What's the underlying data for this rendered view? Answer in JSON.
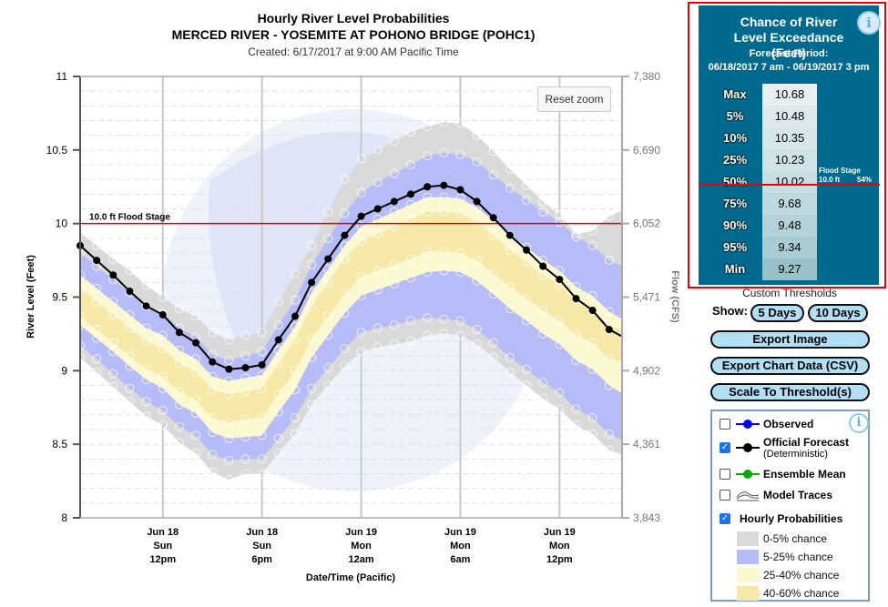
{
  "header": {
    "title": "Hourly River Level Probabilities",
    "subtitle": "MERCED RIVER - YOSEMITE AT POHONO BRIDGE (POHC1)",
    "created": "Created: 6/17/2017 at 9:00 AM Pacific Time"
  },
  "reset_zoom": "Reset zoom",
  "chart_data": {
    "type": "area",
    "title": "Hourly River Level Probabilities",
    "ylabel": "River Level (Feet)",
    "y2label": "Flow (CFS)",
    "xlabel": "Date/Time (Pacific)",
    "ylim": [
      8,
      11
    ],
    "yticks": [
      "11",
      "10.5",
      "10",
      "9.5",
      "9",
      "8.5",
      "8"
    ],
    "y2ticks": [
      "7,380",
      "6,690",
      "6,052",
      "5,471",
      "4,902",
      "4,361",
      "3,843"
    ],
    "xticks": [
      {
        "at": "06/18 12:00",
        "l1": "Jun 18",
        "l2": "Sun",
        "l3": "12pm"
      },
      {
        "at": "06/18 18:00",
        "l1": "Jun 18",
        "l2": "Sun",
        "l3": "6pm"
      },
      {
        "at": "06/19 00:00",
        "l1": "Jun 19",
        "l2": "Mon",
        "l3": "12am"
      },
      {
        "at": "06/19 06:00",
        "l1": "Jun 19",
        "l2": "Mon",
        "l3": "6am"
      },
      {
        "at": "06/19 12:00",
        "l1": "Jun 19",
        "l2": "Mon",
        "l3": "12pm"
      }
    ],
    "grid": true,
    "flood_stage": {
      "value": 10.0,
      "label": "10.0 ft Flood Stage",
      "color": "#e00000"
    },
    "x": [
      "06/18 07:00",
      "06/18 08:00",
      "06/18 09:00",
      "06/18 10:00",
      "06/18 11:00",
      "06/18 12:00",
      "06/18 13:00",
      "06/18 14:00",
      "06/18 15:00",
      "06/18 16:00",
      "06/18 17:00",
      "06/18 18:00",
      "06/18 19:00",
      "06/18 20:00",
      "06/18 21:00",
      "06/18 22:00",
      "06/18 23:00",
      "06/19 00:00",
      "06/19 01:00",
      "06/19 02:00",
      "06/19 03:00",
      "06/19 04:00",
      "06/19 05:00",
      "06/19 06:00",
      "06/19 07:00",
      "06/19 08:00",
      "06/19 09:00",
      "06/19 10:00",
      "06/19 11:00",
      "06/19 12:00",
      "06/19 13:00",
      "06/19 14:00",
      "06/19 15:00",
      "06/19 16:00"
    ],
    "forecast": [
      9.85,
      9.75,
      9.65,
      9.54,
      9.44,
      9.38,
      9.26,
      9.19,
      9.06,
      9.01,
      9.02,
      9.04,
      9.21,
      9.37,
      9.6,
      9.76,
      9.92,
      10.05,
      10.1,
      10.15,
      10.2,
      10.25,
      10.26,
      10.23,
      10.15,
      10.04,
      9.92,
      9.82,
      9.71,
      9.62,
      9.49,
      9.41,
      9.28,
      9.22
    ],
    "bands": {
      "max": [
        9.94,
        9.85,
        9.76,
        9.68,
        9.58,
        9.5,
        9.42,
        9.37,
        9.26,
        9.21,
        9.24,
        9.26,
        9.47,
        9.66,
        9.85,
        10.08,
        10.3,
        10.44,
        10.5,
        10.56,
        10.62,
        10.66,
        10.69,
        10.68,
        10.6,
        10.49,
        10.37,
        10.26,
        10.15,
        10.06,
        9.93,
        9.95,
        10.05,
        10.1
      ],
      "p5": [
        9.8,
        9.71,
        9.62,
        9.53,
        9.44,
        9.39,
        9.29,
        9.23,
        9.11,
        9.07,
        9.1,
        9.13,
        9.31,
        9.48,
        9.72,
        9.9,
        10.07,
        10.21,
        10.28,
        10.34,
        10.4,
        10.46,
        10.48,
        10.47,
        10.42,
        10.33,
        10.24,
        10.16,
        10.08,
        10.01,
        9.91,
        9.85,
        9.75,
        9.7
      ],
      "p25": [
        9.65,
        9.56,
        9.47,
        9.38,
        9.29,
        9.24,
        9.14,
        9.08,
        8.96,
        8.93,
        8.95,
        8.97,
        9.14,
        9.3,
        9.53,
        9.69,
        9.85,
        9.98,
        10.03,
        10.08,
        10.13,
        10.18,
        10.18,
        10.17,
        10.11,
        10.02,
        9.92,
        9.84,
        9.75,
        9.68,
        9.57,
        9.51,
        9.4,
        9.34
      ],
      "p40": [
        9.56,
        9.47,
        9.38,
        9.29,
        9.2,
        9.15,
        9.05,
        8.99,
        8.87,
        8.84,
        8.86,
        8.88,
        9.05,
        9.21,
        9.44,
        9.6,
        9.76,
        9.88,
        9.93,
        9.98,
        10.03,
        10.08,
        10.08,
        10.07,
        10.01,
        9.92,
        9.82,
        9.74,
        9.65,
        9.58,
        9.47,
        9.41,
        9.3,
        9.27
      ],
      "p60": [
        9.37,
        9.28,
        9.19,
        9.1,
        9.01,
        8.96,
        8.86,
        8.8,
        8.68,
        8.65,
        8.67,
        8.68,
        8.84,
        9.0,
        9.22,
        9.37,
        9.52,
        9.64,
        9.68,
        9.72,
        9.76,
        9.81,
        9.81,
        9.8,
        9.75,
        9.66,
        9.57,
        9.49,
        9.41,
        9.34,
        9.24,
        9.19,
        9.08,
        9.05
      ],
      "p75": [
        9.31,
        9.22,
        9.13,
        9.03,
        8.94,
        8.88,
        8.77,
        8.71,
        8.58,
        8.54,
        8.55,
        8.56,
        8.72,
        8.87,
        9.09,
        9.24,
        9.39,
        9.51,
        9.55,
        9.59,
        9.63,
        9.67,
        9.68,
        9.67,
        9.61,
        9.52,
        9.42,
        9.34,
        9.25,
        9.18,
        9.07,
        9.01,
        8.9,
        8.83
      ],
      "p95": [
        9.17,
        9.08,
        8.98,
        8.88,
        8.79,
        8.73,
        8.62,
        8.56,
        8.43,
        8.39,
        8.4,
        8.4,
        8.54,
        8.68,
        8.88,
        9.02,
        9.15,
        9.26,
        9.29,
        9.31,
        9.34,
        9.36,
        9.35,
        9.34,
        9.28,
        9.19,
        9.09,
        9.01,
        8.92,
        8.85,
        8.74,
        8.68,
        8.57,
        8.52
      ],
      "min": [
        9.09,
        8.99,
        8.89,
        8.79,
        8.69,
        8.63,
        8.51,
        8.44,
        8.31,
        8.26,
        8.3,
        8.3,
        8.44,
        8.57,
        8.77,
        8.9,
        9.03,
        9.13,
        9.16,
        9.18,
        9.2,
        9.24,
        9.25,
        9.24,
        9.18,
        9.09,
        8.99,
        8.9,
        8.81,
        8.74,
        8.63,
        8.57,
        8.46,
        8.42
      ]
    },
    "colors": {
      "0-5": "#d9d9d9",
      "5-25": "#b5bcf7",
      "25-40": "#fbf8cf",
      "40-60": "#f6e9a8",
      "forecast": "#000000"
    }
  },
  "exceedance": {
    "title": "Chance of River Level Exceedance (Feet)",
    "period_label": "Forecast Period:",
    "period": "06/18/2017 7 am - 06/19/2017 3 pm",
    "rows": [
      {
        "label": "Max",
        "value": "10.68"
      },
      {
        "label": "5%",
        "value": "10.48"
      },
      {
        "label": "10%",
        "value": "10.35"
      },
      {
        "label": "25%",
        "value": "10.23"
      },
      {
        "label": "50%",
        "value": "10.02"
      },
      {
        "label": "75%",
        "value": "9.68"
      },
      {
        "label": "90%",
        "value": "9.48"
      },
      {
        "label": "95%",
        "value": "9.34"
      },
      {
        "label": "Min",
        "value": "9.27"
      }
    ],
    "flood_stage_label": "Flood Stage",
    "flood_stage_value": "10.0 ft",
    "flood_stage_chance": "54%",
    "bg": "#006a8e"
  },
  "controls": {
    "custom_thresholds": "Custom Thresholds",
    "show": "Show:",
    "five_days": "5 Days",
    "ten_days": "10 Days",
    "export_image": "Export Image",
    "export_csv": "Export Chart Data (CSV)",
    "scale": "Scale To Threshold(s)"
  },
  "legend": {
    "observed": "Observed",
    "official": "Official Forecast",
    "official_sub": "(Deterministic)",
    "ensemble": "Ensemble Mean",
    "traces": "Model Traces",
    "hourly": "Hourly Probabilities",
    "observed_checked": false,
    "official_checked": true,
    "ensemble_checked": false,
    "traces_checked": false,
    "hourly_checked": true,
    "bands": [
      "0-5% chance",
      "5-25% chance",
      "25-40% chance",
      "40-60% chance"
    ]
  }
}
